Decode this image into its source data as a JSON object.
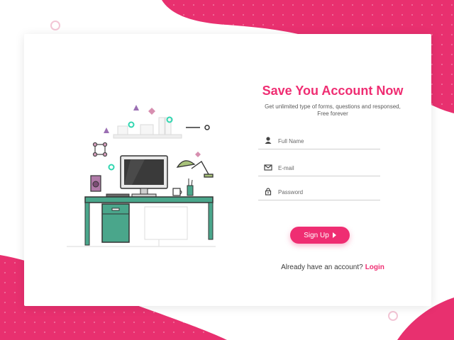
{
  "colors": {
    "accent": "#ef2d72",
    "background": "#ffffff"
  },
  "signup": {
    "title": "Save You Account Now",
    "subtitle_line1": "Get unlimited type of forms, questions and responsed,",
    "subtitle_line2": "Free forever",
    "fields": [
      {
        "icon": "user-icon",
        "placeholder": "Full Name"
      },
      {
        "icon": "mail-icon",
        "placeholder": "E-mail"
      },
      {
        "icon": "lock-icon",
        "placeholder": "Password"
      }
    ],
    "submit_label": "Sign Up",
    "login_prompt": "Already have an account?",
    "login_link": "Login"
  }
}
